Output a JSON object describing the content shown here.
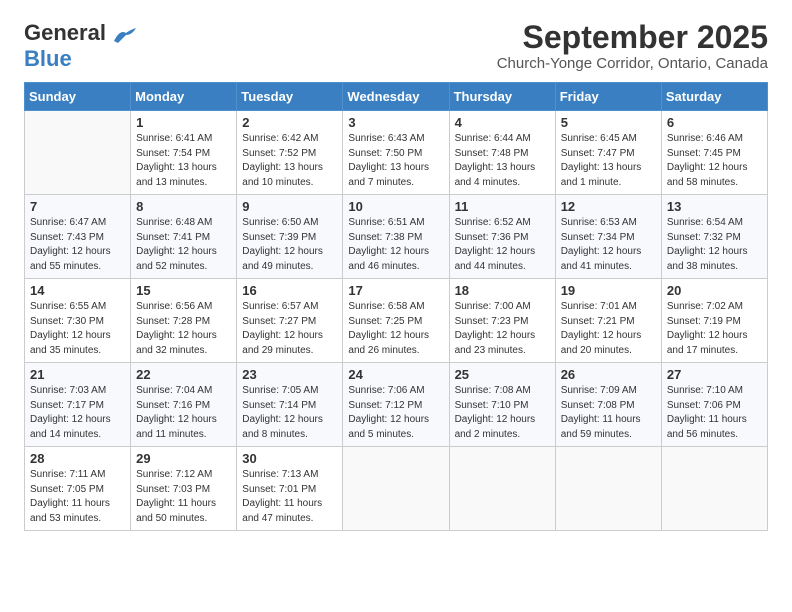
{
  "logo": {
    "line1": "General",
    "line2": "Blue"
  },
  "title": "September 2025",
  "subtitle": "Church-Yonge Corridor, Ontario, Canada",
  "days_of_week": [
    "Sunday",
    "Monday",
    "Tuesday",
    "Wednesday",
    "Thursday",
    "Friday",
    "Saturday"
  ],
  "weeks": [
    [
      {
        "day": "",
        "sunrise": "",
        "sunset": "",
        "daylight": ""
      },
      {
        "day": "1",
        "sunrise": "Sunrise: 6:41 AM",
        "sunset": "Sunset: 7:54 PM",
        "daylight": "Daylight: 13 hours and 13 minutes."
      },
      {
        "day": "2",
        "sunrise": "Sunrise: 6:42 AM",
        "sunset": "Sunset: 7:52 PM",
        "daylight": "Daylight: 13 hours and 10 minutes."
      },
      {
        "day": "3",
        "sunrise": "Sunrise: 6:43 AM",
        "sunset": "Sunset: 7:50 PM",
        "daylight": "Daylight: 13 hours and 7 minutes."
      },
      {
        "day": "4",
        "sunrise": "Sunrise: 6:44 AM",
        "sunset": "Sunset: 7:48 PM",
        "daylight": "Daylight: 13 hours and 4 minutes."
      },
      {
        "day": "5",
        "sunrise": "Sunrise: 6:45 AM",
        "sunset": "Sunset: 7:47 PM",
        "daylight": "Daylight: 13 hours and 1 minute."
      },
      {
        "day": "6",
        "sunrise": "Sunrise: 6:46 AM",
        "sunset": "Sunset: 7:45 PM",
        "daylight": "Daylight: 12 hours and 58 minutes."
      }
    ],
    [
      {
        "day": "7",
        "sunrise": "Sunrise: 6:47 AM",
        "sunset": "Sunset: 7:43 PM",
        "daylight": "Daylight: 12 hours and 55 minutes."
      },
      {
        "day": "8",
        "sunrise": "Sunrise: 6:48 AM",
        "sunset": "Sunset: 7:41 PM",
        "daylight": "Daylight: 12 hours and 52 minutes."
      },
      {
        "day": "9",
        "sunrise": "Sunrise: 6:50 AM",
        "sunset": "Sunset: 7:39 PM",
        "daylight": "Daylight: 12 hours and 49 minutes."
      },
      {
        "day": "10",
        "sunrise": "Sunrise: 6:51 AM",
        "sunset": "Sunset: 7:38 PM",
        "daylight": "Daylight: 12 hours and 46 minutes."
      },
      {
        "day": "11",
        "sunrise": "Sunrise: 6:52 AM",
        "sunset": "Sunset: 7:36 PM",
        "daylight": "Daylight: 12 hours and 44 minutes."
      },
      {
        "day": "12",
        "sunrise": "Sunrise: 6:53 AM",
        "sunset": "Sunset: 7:34 PM",
        "daylight": "Daylight: 12 hours and 41 minutes."
      },
      {
        "day": "13",
        "sunrise": "Sunrise: 6:54 AM",
        "sunset": "Sunset: 7:32 PM",
        "daylight": "Daylight: 12 hours and 38 minutes."
      }
    ],
    [
      {
        "day": "14",
        "sunrise": "Sunrise: 6:55 AM",
        "sunset": "Sunset: 7:30 PM",
        "daylight": "Daylight: 12 hours and 35 minutes."
      },
      {
        "day": "15",
        "sunrise": "Sunrise: 6:56 AM",
        "sunset": "Sunset: 7:28 PM",
        "daylight": "Daylight: 12 hours and 32 minutes."
      },
      {
        "day": "16",
        "sunrise": "Sunrise: 6:57 AM",
        "sunset": "Sunset: 7:27 PM",
        "daylight": "Daylight: 12 hours and 29 minutes."
      },
      {
        "day": "17",
        "sunrise": "Sunrise: 6:58 AM",
        "sunset": "Sunset: 7:25 PM",
        "daylight": "Daylight: 12 hours and 26 minutes."
      },
      {
        "day": "18",
        "sunrise": "Sunrise: 7:00 AM",
        "sunset": "Sunset: 7:23 PM",
        "daylight": "Daylight: 12 hours and 23 minutes."
      },
      {
        "day": "19",
        "sunrise": "Sunrise: 7:01 AM",
        "sunset": "Sunset: 7:21 PM",
        "daylight": "Daylight: 12 hours and 20 minutes."
      },
      {
        "day": "20",
        "sunrise": "Sunrise: 7:02 AM",
        "sunset": "Sunset: 7:19 PM",
        "daylight": "Daylight: 12 hours and 17 minutes."
      }
    ],
    [
      {
        "day": "21",
        "sunrise": "Sunrise: 7:03 AM",
        "sunset": "Sunset: 7:17 PM",
        "daylight": "Daylight: 12 hours and 14 minutes."
      },
      {
        "day": "22",
        "sunrise": "Sunrise: 7:04 AM",
        "sunset": "Sunset: 7:16 PM",
        "daylight": "Daylight: 12 hours and 11 minutes."
      },
      {
        "day": "23",
        "sunrise": "Sunrise: 7:05 AM",
        "sunset": "Sunset: 7:14 PM",
        "daylight": "Daylight: 12 hours and 8 minutes."
      },
      {
        "day": "24",
        "sunrise": "Sunrise: 7:06 AM",
        "sunset": "Sunset: 7:12 PM",
        "daylight": "Daylight: 12 hours and 5 minutes."
      },
      {
        "day": "25",
        "sunrise": "Sunrise: 7:08 AM",
        "sunset": "Sunset: 7:10 PM",
        "daylight": "Daylight: 12 hours and 2 minutes."
      },
      {
        "day": "26",
        "sunrise": "Sunrise: 7:09 AM",
        "sunset": "Sunset: 7:08 PM",
        "daylight": "Daylight: 11 hours and 59 minutes."
      },
      {
        "day": "27",
        "sunrise": "Sunrise: 7:10 AM",
        "sunset": "Sunset: 7:06 PM",
        "daylight": "Daylight: 11 hours and 56 minutes."
      }
    ],
    [
      {
        "day": "28",
        "sunrise": "Sunrise: 7:11 AM",
        "sunset": "Sunset: 7:05 PM",
        "daylight": "Daylight: 11 hours and 53 minutes."
      },
      {
        "day": "29",
        "sunrise": "Sunrise: 7:12 AM",
        "sunset": "Sunset: 7:03 PM",
        "daylight": "Daylight: 11 hours and 50 minutes."
      },
      {
        "day": "30",
        "sunrise": "Sunrise: 7:13 AM",
        "sunset": "Sunset: 7:01 PM",
        "daylight": "Daylight: 11 hours and 47 minutes."
      },
      {
        "day": "",
        "sunrise": "",
        "sunset": "",
        "daylight": ""
      },
      {
        "day": "",
        "sunrise": "",
        "sunset": "",
        "daylight": ""
      },
      {
        "day": "",
        "sunrise": "",
        "sunset": "",
        "daylight": ""
      },
      {
        "day": "",
        "sunrise": "",
        "sunset": "",
        "daylight": ""
      }
    ]
  ]
}
